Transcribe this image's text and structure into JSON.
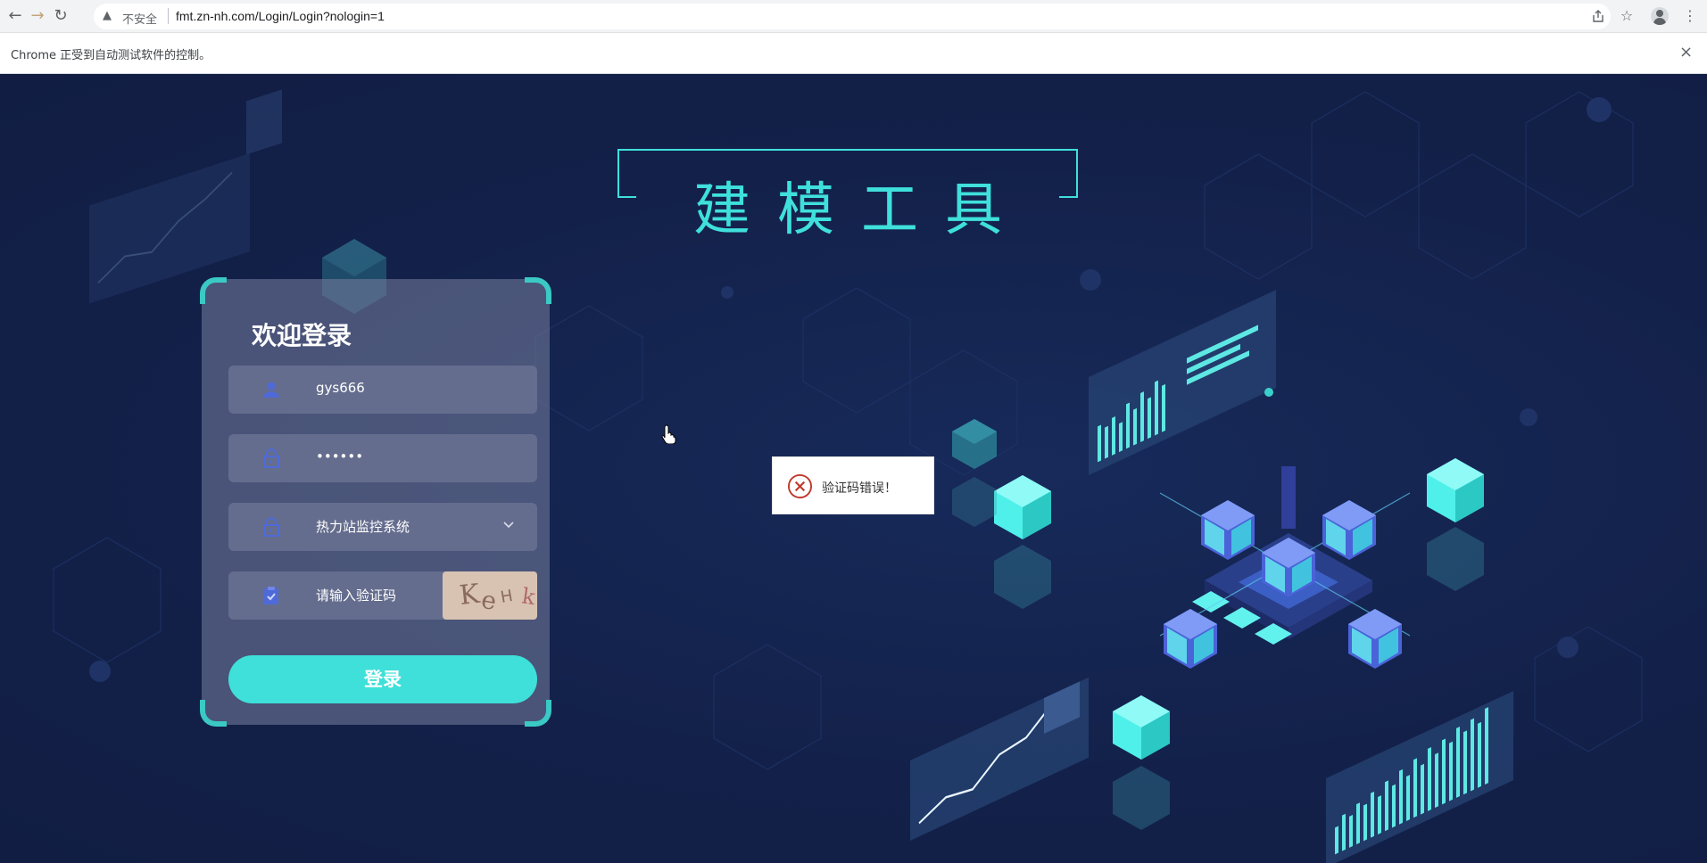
{
  "browser": {
    "nav_back": "←",
    "nav_forward": "→",
    "reload": "↻",
    "security_label": "不安全",
    "url": "fmt.zn-nh.com/Login/Login?nologin=1",
    "infobar_message": "Chrome 正受到自动测试软件的控制。",
    "infobar_close": "×",
    "icons": [
      "share-icon",
      "star-icon",
      "profile-icon",
      "menu-icon"
    ]
  },
  "page": {
    "title": "建模工具",
    "accent_color": "#3fe0dc",
    "background_color": "#13214a"
  },
  "login": {
    "heading": "欢迎登录",
    "username_value": "gys666",
    "password_value": "••••••",
    "system_selected": "热力站监控系统",
    "captcha_placeholder": "请输入验证码",
    "captcha_text": "KeHk",
    "submit_label": "登录"
  },
  "toast": {
    "message": "验证码错误！",
    "type": "error"
  }
}
